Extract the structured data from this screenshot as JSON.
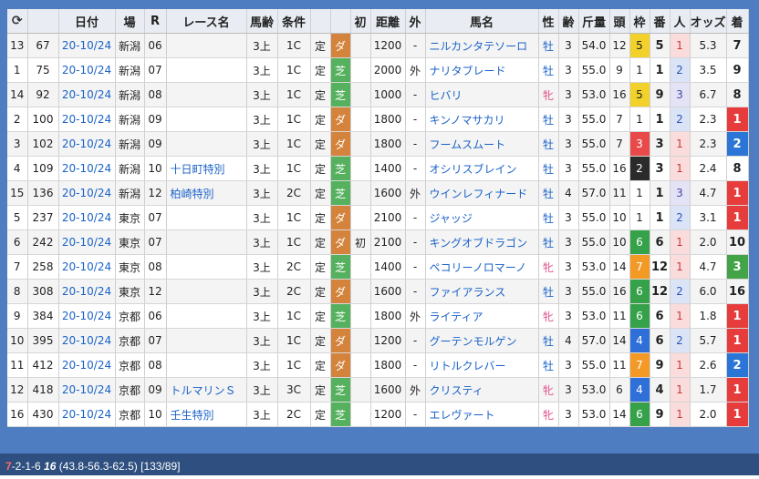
{
  "header": {
    "refresh_icon": "refresh-icon",
    "date": "日付",
    "place": "場",
    "race_no": "R",
    "race_name": "レース名",
    "age": "馬齢",
    "cond": "条件",
    "first": "初",
    "dist": "距離",
    "out": "外",
    "horse": "馬名",
    "sex": "性",
    "years": "齢",
    "weight": "斤量",
    "count": "頭",
    "waku": "枠",
    "ban": "番",
    "pop": "人",
    "odds": "オッズ",
    "place_rank": "着"
  },
  "rows": [
    {
      "idx": "13",
      "num": "67",
      "date": "20-10/24",
      "place": "新潟",
      "r": "06",
      "race": "",
      "age": "3上",
      "cond": "1C",
      "fix": "定",
      "surf": "ダ",
      "surf_type": "d",
      "first": "",
      "dist": "1200",
      "out": "-",
      "horse": "ニルカンタテソーロ",
      "sex": "牡",
      "years": "3",
      "weight": "54.0",
      "count": "12",
      "waku": "5",
      "ban": "5",
      "pop": "1",
      "odds": "5.3",
      "pl": "7"
    },
    {
      "idx": "1",
      "num": "75",
      "date": "20-10/24",
      "place": "新潟",
      "r": "07",
      "race": "",
      "age": "3上",
      "cond": "1C",
      "fix": "定",
      "surf": "芝",
      "surf_type": "t",
      "first": "",
      "dist": "2000",
      "out": "外",
      "horse": "ナリタブレード",
      "sex": "牡",
      "years": "3",
      "weight": "55.0",
      "count": "9",
      "waku": "1",
      "ban": "1",
      "pop": "2",
      "odds": "3.5",
      "pl": "9"
    },
    {
      "idx": "14",
      "num": "92",
      "date": "20-10/24",
      "place": "新潟",
      "r": "08",
      "race": "",
      "age": "3上",
      "cond": "1C",
      "fix": "定",
      "surf": "芝",
      "surf_type": "t",
      "first": "",
      "dist": "1000",
      "out": "-",
      "horse": "ヒバリ",
      "sex": "牝",
      "years": "3",
      "weight": "53.0",
      "count": "16",
      "waku": "5",
      "ban": "9",
      "pop": "3",
      "odds": "6.7",
      "pl": "8"
    },
    {
      "idx": "2",
      "num": "100",
      "date": "20-10/24",
      "place": "新潟",
      "r": "09",
      "race": "",
      "age": "3上",
      "cond": "1C",
      "fix": "定",
      "surf": "ダ",
      "surf_type": "d",
      "first": "",
      "dist": "1800",
      "out": "-",
      "horse": "キンノマサカリ",
      "sex": "牡",
      "years": "3",
      "weight": "55.0",
      "count": "7",
      "waku": "1",
      "ban": "1",
      "pop": "2",
      "odds": "2.3",
      "pl": "1"
    },
    {
      "idx": "3",
      "num": "102",
      "date": "20-10/24",
      "place": "新潟",
      "r": "09",
      "race": "",
      "age": "3上",
      "cond": "1C",
      "fix": "定",
      "surf": "ダ",
      "surf_type": "d",
      "first": "",
      "dist": "1800",
      "out": "-",
      "horse": "フームスムート",
      "sex": "牡",
      "years": "3",
      "weight": "55.0",
      "count": "7",
      "waku": "3",
      "ban": "3",
      "pop": "1",
      "odds": "2.3",
      "pl": "2"
    },
    {
      "idx": "4",
      "num": "109",
      "date": "20-10/24",
      "place": "新潟",
      "r": "10",
      "race": "十日町特別",
      "age": "3上",
      "cond": "1C",
      "fix": "定",
      "surf": "芝",
      "surf_type": "t",
      "first": "",
      "dist": "1400",
      "out": "-",
      "horse": "オシリスブレイン",
      "sex": "牡",
      "years": "3",
      "weight": "55.0",
      "count": "16",
      "waku": "2",
      "ban": "3",
      "pop": "1",
      "odds": "2.4",
      "pl": "8"
    },
    {
      "idx": "15",
      "num": "136",
      "date": "20-10/24",
      "place": "新潟",
      "r": "12",
      "race": "柏崎特別",
      "age": "3上",
      "cond": "2C",
      "fix": "定",
      "surf": "芝",
      "surf_type": "t",
      "first": "",
      "dist": "1600",
      "out": "外",
      "horse": "ウインレフィナード",
      "sex": "牡",
      "years": "4",
      "weight": "57.0",
      "count": "11",
      "waku": "1",
      "ban": "1",
      "pop": "3",
      "odds": "4.7",
      "pl": "1"
    },
    {
      "idx": "5",
      "num": "237",
      "date": "20-10/24",
      "place": "東京",
      "r": "07",
      "race": "",
      "age": "3上",
      "cond": "1C",
      "fix": "定",
      "surf": "ダ",
      "surf_type": "d",
      "first": "",
      "dist": "2100",
      "out": "-",
      "horse": "ジャッジ",
      "sex": "牡",
      "years": "3",
      "weight": "55.0",
      "count": "10",
      "waku": "1",
      "ban": "1",
      "pop": "2",
      "odds": "3.1",
      "pl": "1"
    },
    {
      "idx": "6",
      "num": "242",
      "date": "20-10/24",
      "place": "東京",
      "r": "07",
      "race": "",
      "age": "3上",
      "cond": "1C",
      "fix": "定",
      "surf": "ダ",
      "surf_type": "d",
      "first": "初",
      "dist": "2100",
      "out": "-",
      "horse": "キングオブドラゴン",
      "sex": "牡",
      "years": "3",
      "weight": "55.0",
      "count": "10",
      "waku": "6",
      "ban": "6",
      "pop": "1",
      "odds": "2.0",
      "pl": "10"
    },
    {
      "idx": "7",
      "num": "258",
      "date": "20-10/24",
      "place": "東京",
      "r": "08",
      "race": "",
      "age": "3上",
      "cond": "2C",
      "fix": "定",
      "surf": "芝",
      "surf_type": "t",
      "first": "",
      "dist": "1400",
      "out": "-",
      "horse": "ペコリーノロマーノ",
      "sex": "牝",
      "years": "3",
      "weight": "53.0",
      "count": "14",
      "waku": "7",
      "ban": "12",
      "pop": "1",
      "odds": "4.7",
      "pl": "3"
    },
    {
      "idx": "8",
      "num": "308",
      "date": "20-10/24",
      "place": "東京",
      "r": "12",
      "race": "",
      "age": "3上",
      "cond": "2C",
      "fix": "定",
      "surf": "ダ",
      "surf_type": "d",
      "first": "",
      "dist": "1600",
      "out": "-",
      "horse": "ファイアランス",
      "sex": "牡",
      "years": "3",
      "weight": "55.0",
      "count": "16",
      "waku": "6",
      "ban": "12",
      "pop": "2",
      "odds": "6.0",
      "pl": "16"
    },
    {
      "idx": "9",
      "num": "384",
      "date": "20-10/24",
      "place": "京都",
      "r": "06",
      "race": "",
      "age": "3上",
      "cond": "1C",
      "fix": "定",
      "surf": "芝",
      "surf_type": "t",
      "first": "",
      "dist": "1800",
      "out": "外",
      "horse": "ライティア",
      "sex": "牝",
      "years": "3",
      "weight": "53.0",
      "count": "11",
      "waku": "6",
      "ban": "6",
      "pop": "1",
      "odds": "1.8",
      "pl": "1"
    },
    {
      "idx": "10",
      "num": "395",
      "date": "20-10/24",
      "place": "京都",
      "r": "07",
      "race": "",
      "age": "3上",
      "cond": "1C",
      "fix": "定",
      "surf": "ダ",
      "surf_type": "d",
      "first": "",
      "dist": "1200",
      "out": "-",
      "horse": "グーテンモルゲン",
      "sex": "牡",
      "years": "4",
      "weight": "57.0",
      "count": "14",
      "waku": "4",
      "ban": "6",
      "pop": "2",
      "odds": "5.7",
      "pl": "1"
    },
    {
      "idx": "11",
      "num": "412",
      "date": "20-10/24",
      "place": "京都",
      "r": "08",
      "race": "",
      "age": "3上",
      "cond": "1C",
      "fix": "定",
      "surf": "ダ",
      "surf_type": "d",
      "first": "",
      "dist": "1800",
      "out": "-",
      "horse": "リトルクレバー",
      "sex": "牡",
      "years": "3",
      "weight": "55.0",
      "count": "11",
      "waku": "7",
      "ban": "9",
      "pop": "1",
      "odds": "2.6",
      "pl": "2"
    },
    {
      "idx": "12",
      "num": "418",
      "date": "20-10/24",
      "place": "京都",
      "r": "09",
      "race": "トルマリンＳ",
      "age": "3上",
      "cond": "3C",
      "fix": "定",
      "surf": "芝",
      "surf_type": "t",
      "first": "",
      "dist": "1600",
      "out": "外",
      "horse": "クリスティ",
      "sex": "牝",
      "years": "3",
      "weight": "53.0",
      "count": "6",
      "waku": "4",
      "ban": "4",
      "pop": "1",
      "odds": "1.7",
      "pl": "1"
    },
    {
      "idx": "16",
      "num": "430",
      "date": "20-10/24",
      "place": "京都",
      "r": "10",
      "race": "壬生特別",
      "age": "3上",
      "cond": "2C",
      "fix": "定",
      "surf": "芝",
      "surf_type": "t",
      "first": "",
      "dist": "1200",
      "out": "-",
      "horse": "エレヴァート",
      "sex": "牝",
      "years": "3",
      "weight": "53.0",
      "count": "14",
      "waku": "6",
      "ban": "9",
      "pop": "1",
      "odds": "2.0",
      "pl": "1"
    }
  ],
  "footer": {
    "lead": "7",
    "seq": "-2-1-6 ",
    "bold": "16",
    "rest": " (43.8-56.3-62.5) [133/89]"
  }
}
